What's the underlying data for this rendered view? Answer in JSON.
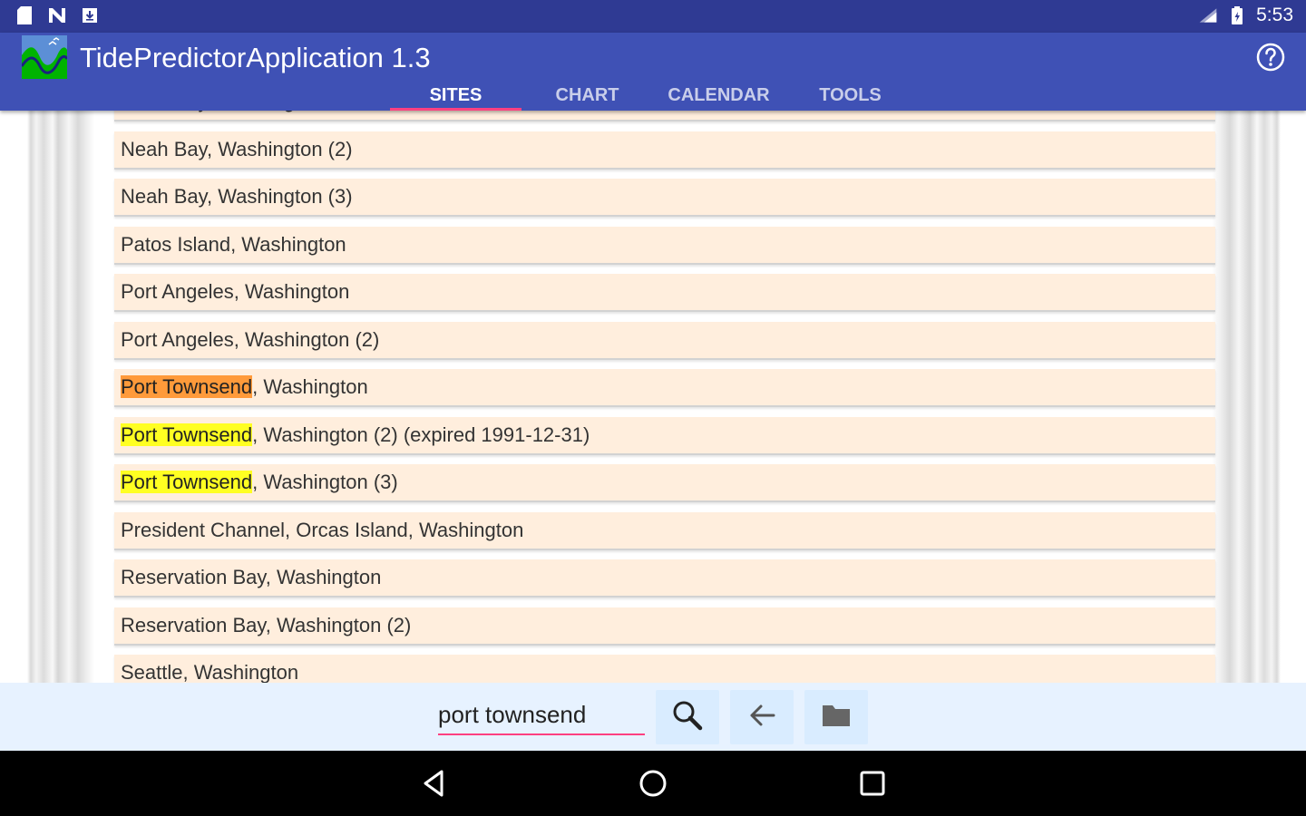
{
  "status_bar": {
    "time": "5:53",
    "icons": [
      "sd-card-icon",
      "n-icon",
      "download-icon",
      "signal-icon",
      "battery-icon"
    ]
  },
  "app_bar": {
    "title": "TidePredictorApplication 1.3",
    "icon": "wave-logo-icon",
    "help_icon": "help-icon",
    "tabs": [
      {
        "label": "SITES",
        "active": true
      },
      {
        "label": "CHART",
        "active": false
      },
      {
        "label": "CALENDAR",
        "active": false
      },
      {
        "label": "TOOLS",
        "active": false
      }
    ]
  },
  "sites": [
    {
      "prefix": "Neah Bay, Washington",
      "match": "",
      "suffix": ""
    },
    {
      "prefix": "Neah Bay, Washington (2)",
      "match": "",
      "suffix": ""
    },
    {
      "prefix": "Neah Bay, Washington (3)",
      "match": "",
      "suffix": ""
    },
    {
      "prefix": "Patos Island, Washington",
      "match": "",
      "suffix": ""
    },
    {
      "prefix": "Port Angeles, Washington",
      "match": "",
      "suffix": ""
    },
    {
      "prefix": "Port Angeles, Washington (2)",
      "match": "",
      "suffix": ""
    },
    {
      "prefix": "",
      "match": "Port Townsend",
      "suffix": ", Washington",
      "highlight": "orange"
    },
    {
      "prefix": "",
      "match": "Port Townsend",
      "suffix": ", Washington (2) (expired 1991-12-31)",
      "highlight": "yellow"
    },
    {
      "prefix": "",
      "match": "Port Townsend",
      "suffix": ", Washington (3)",
      "highlight": "yellow"
    },
    {
      "prefix": "President Channel, Orcas Island, Washington",
      "match": "",
      "suffix": ""
    },
    {
      "prefix": "Reservation Bay, Washington",
      "match": "",
      "suffix": ""
    },
    {
      "prefix": "Reservation Bay, Washington (2)",
      "match": "",
      "suffix": ""
    },
    {
      "prefix": "Seattle, Washington",
      "match": "",
      "suffix": ""
    }
  ],
  "search": {
    "value": "port townsend",
    "buttons": [
      "search-icon",
      "back-arrow-icon",
      "folder-icon"
    ]
  },
  "nav_bar": [
    "back-triangle-icon",
    "home-circle-icon",
    "recents-square-icon"
  ],
  "colors": {
    "status_bar": "#2f3a93",
    "app_bar": "#3f51b5",
    "tab_indicator": "#ff4081",
    "row_background": "#ffeedd",
    "highlight_current": "#ff9a3a",
    "highlight_other": "#ffff22",
    "search_bar": "#e7f2ff"
  }
}
